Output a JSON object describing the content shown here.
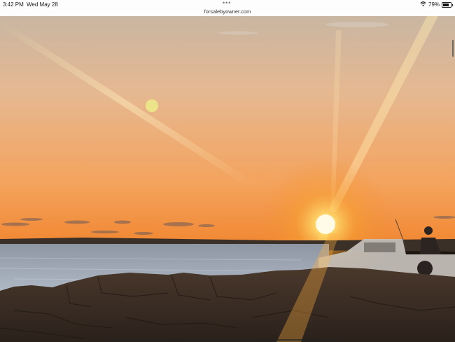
{
  "status_bar": {
    "time": "3:42 PM",
    "date": "Wed May 28",
    "url": "forsalebyowner.com",
    "battery_percent": "79%",
    "battery_level": 0.79,
    "icons": [
      "multitask-dots-icon",
      "wifi-icon",
      "battery-icon"
    ]
  },
  "photo": {
    "subject": "sunset-over-water",
    "colors": {
      "sky_top": "#f0c8a0",
      "sky_horizon": "#f08a30",
      "sun": "#fff2b0",
      "water": "#9aa8b8",
      "rocks": "#3a2c24"
    }
  }
}
